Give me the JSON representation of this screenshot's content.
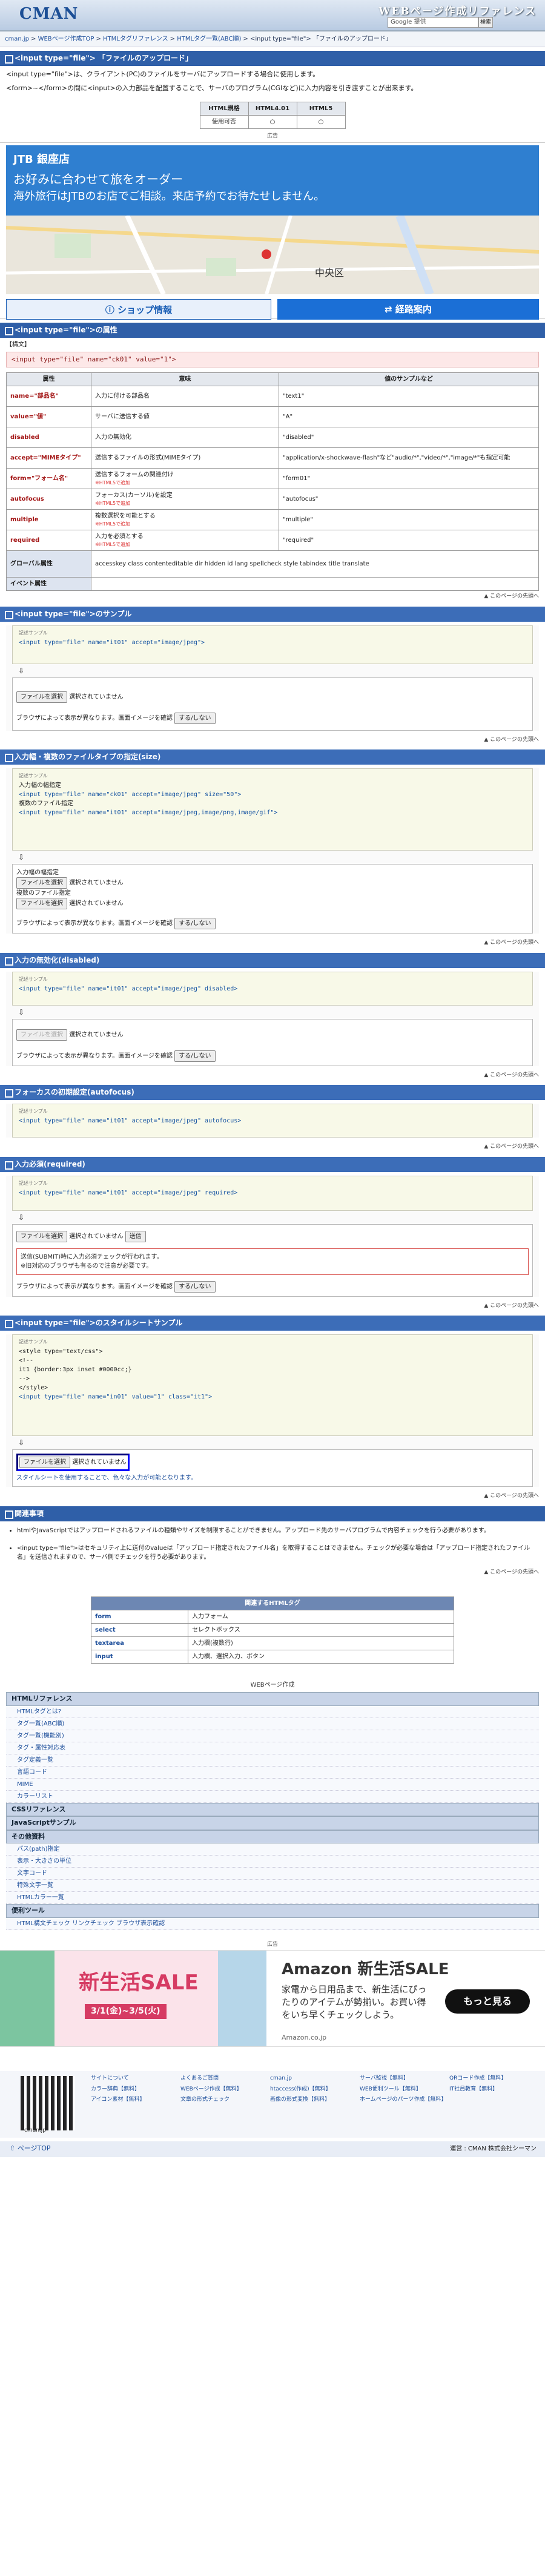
{
  "header": {
    "logo": "CMAN",
    "site_title": "WEBページ作成リファレンス",
    "search_placeholder": "Google 提供",
    "search_btn": "検索"
  },
  "breadcrumb": [
    "cman.jp",
    "WEBページ作成TOP",
    "HTMLタグリファレンス",
    "HTMLタグ一覧(ABC順)",
    "<input type=\"file\"> 「ファイルのアップロード」"
  ],
  "title": "<input type=\"file\"> 「ファイルのアップロード」",
  "intro1": "<input type=\"file\">は、クライアント(PC)のファイルをサーバにアップロードする場合に使用します。",
  "intro2": "<form>~</form>の間に<input>の入力部品を配置することで、サーバのプログラム(CGIなど)に入力内容を引き渡すことが出来ます。",
  "browser": {
    "headers": [
      "HTML規格",
      "HTML4.01",
      "HTML5"
    ],
    "row": [
      "使用可否",
      "○",
      "○"
    ]
  },
  "ad_label": "広告",
  "jtb": {
    "brand": "JTB 銀座店",
    "line1": "お好みに合わせて旅をオーダー",
    "line2": "海外旅行はJTBのお店でご相談。来店予約でお待たせしません。",
    "map_label": "中央区",
    "btn1": "ショップ情報",
    "btn2": "経路案内"
  },
  "attr_title": "<input type=\"file\">の属性",
  "syntax_lbl": "【構文】",
  "syntax": "<input type=\"file\" name=\"ck01\" value=\"1\">",
  "attr_headers": [
    "属性",
    "意味",
    "値のサンプルなど"
  ],
  "attrs": [
    [
      "name=\"部品名\"",
      "入力に付ける部品名",
      "\"text1\"",
      ""
    ],
    [
      "value=\"値\"",
      "サーバに送信する値",
      "\"A\"",
      ""
    ],
    [
      "disabled",
      "入力の無効化",
      "\"disabled\"",
      ""
    ],
    [
      "accept=\"MIMEタイプ\"",
      "送信するファイルの形式(MIMEタイプ)",
      "\"application/x-shockwave-flash\"など\"audio/*\",\"video/*\",\"image/*\"も指定可能",
      ""
    ],
    [
      "form=\"フォーム名\"",
      "送信するフォームの関連付け",
      "\"form01\"",
      "※HTML5で追加"
    ],
    [
      "autofocus",
      "フォーカス(カーソル)を設定",
      "\"autofocus\"",
      "※HTML5で追加"
    ],
    [
      "multiple",
      "複数選択を可能とする",
      "\"multiple\"",
      "※HTML5で追加"
    ],
    [
      "required",
      "入力を必須とする",
      "\"required\"",
      "※HTML5で追加"
    ]
  ],
  "global_lbl": "グローバル属性",
  "global_val": "accesskey class contenteditable dir hidden id lang spellcheck style tabindex title translate",
  "event_lbl": "イベント属性",
  "toplink": "このページの先頭へ",
  "s1": {
    "title": "<input type=\"file\">のサンプル",
    "code": "<input type=\"file\" name=\"it01\" accept=\"image/jpeg\">",
    "note": "ブラウザによって表示が異なります。画面イメージを確認"
  },
  "s2": {
    "title": "入力幅・複数のファイルタイプの指定(size)",
    "c1": "入力幅の幅指定",
    "c2": "<input type=\"file\" name=\"ck01\" accept=\"image/jpeg\" size=\"50\">",
    "c3": "複数のファイル指定",
    "c4": "<input type=\"file\" name=\"it01\" accept=\"image/jpeg,image/png,image/gif\">",
    "r1": "入力幅の幅指定",
    "r2": "複数のファイル指定"
  },
  "s3": {
    "title": "入力の無効化(disabled)",
    "code": "<input type=\"file\" name=\"it01\" accept=\"image/jpeg\" disabled>"
  },
  "s4": {
    "title": "フォーカスの初期設定(autofocus)",
    "code": "<input type=\"file\" name=\"it01\" accept=\"image/jpeg\" autofocus>"
  },
  "s5": {
    "title": "入力必須(required)",
    "code": "<input type=\"file\" name=\"it01\" accept=\"image/jpeg\" required>",
    "send": "送信",
    "msg1": "送信(SUBMIT)時に入力必須チェックが行われます。",
    "msg2": "※旧対応のブラウザも有るので注意が必要です。"
  },
  "s6": {
    "title": "<input type=\"file\">のスタイルシートサンプル",
    "code": [
      "<style type=\"text/css\">",
      "<!--",
      "   it1 {border:3px inset #0000cc;}",
      "-->",
      "</style>",
      "<input type=\"file\" name=\"in01\" value=\"1\" class=\"it1\">"
    ],
    "note": "スタイルシートを使用することで、色々な入力が可能となります。"
  },
  "file_btn": "ファイルを選択",
  "no_file": "選択されていません",
  "show_btn": "する/しない",
  "sample_lbl": "記述サンプル",
  "caution_title": "関連事項",
  "caution": [
    "htmlやJavaScriptではアップロードされるファイルの種類やサイズを制限することができません。アップロード先のサーバプログラムで内容チェックを行う必要があります。",
    "<input type=\"file\">はセキュリティ上に送付のvalueは「アップロード指定されたファイル名」を取得することはできません。チェックが必要な場合は「アップロード指定されたファイル名」を送信されますので、サーバ側でチェックを行う必要があります。"
  ],
  "related": {
    "title": "関連するHTMLタグ",
    "rows": [
      [
        "form",
        "入力フォーム"
      ],
      [
        "select",
        "セレクトボックス"
      ],
      [
        "textarea",
        "入力欄(複数行)"
      ],
      [
        "input",
        "入力欄、選択入力、ボタン"
      ]
    ]
  },
  "menu_title": "WEBページ作成",
  "menu": [
    {
      "h": "HTMLリファレンス",
      "items": [
        "HTMLタグとは?",
        "タグ一覧(ABC順)",
        "タグ一覧(機能別)",
        "タグ・属性対応表",
        "タグ定義一覧",
        "言語コード",
        "MIME",
        "カラーリスト"
      ]
    },
    {
      "h": "CSSリファレンス",
      "items": []
    },
    {
      "h": "JavaScriptサンプル",
      "items": []
    },
    {
      "h": "その他資料",
      "items": [
        "パス(path)指定",
        "表示・大きさの単位",
        "文字コード",
        "特殊文字一覧",
        "HTMLカラー一覧"
      ]
    },
    {
      "h": "便利ツール",
      "items": [
        "HTML構文チェック   リンクチェック   ブラウザ表示確認"
      ]
    }
  ],
  "amazon": {
    "sale": "新生活SALE",
    "title": "Amazon 新生活SALE",
    "dates": "3/1(金)~3/5(火)",
    "text": "家電から日用品まで、新生活にぴったりのアイテムが勢揃い。お買い得をいち早くチェックしよう。",
    "url": "Amazon.co.jp",
    "btn": "もっと見る"
  },
  "footer": {
    "links": [
      "サイトについて",
      "よくあるご質問",
      "cman.jp",
      "サーバ監視【無料】",
      "QRコード作成【無料】",
      "カラー辞典【無料】",
      "WEBページ作成【無料】",
      "htaccess(作成)【無料】",
      "WEB便利ツール【無料】",
      "IT社員教育【無料】",
      "アイコン素材【無料】",
      "文章の形式チェック",
      "画像の形式変換【無料】",
      "ホームページのパーツ作成【無料】"
    ],
    "pagetop": "ページTOP",
    "copyright": "運営 : CMAN 株式会社シーマン"
  }
}
